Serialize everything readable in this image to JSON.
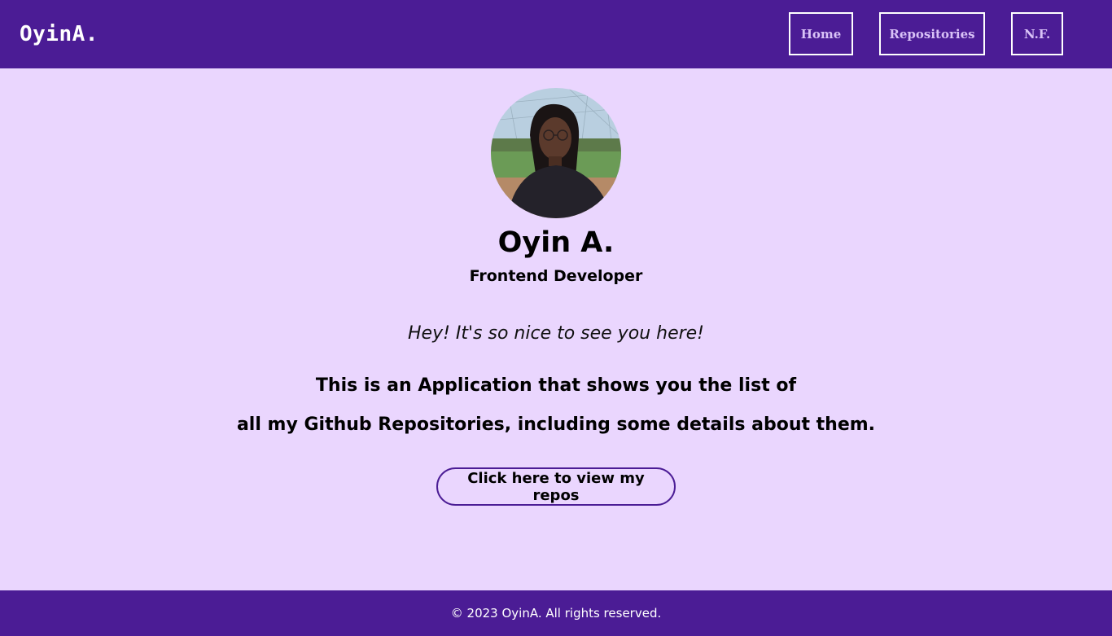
{
  "header": {
    "brand": "OyinA.",
    "nav": [
      {
        "label": "Home"
      },
      {
        "label": "Repositories"
      },
      {
        "label": "N.F."
      }
    ]
  },
  "profile": {
    "name": "Oyin A.",
    "role": "Frontend Developer"
  },
  "intro": {
    "greeting": "Hey! It's so nice to see you here!",
    "description_line1": "This is an Application that shows you the list of",
    "description_line2": "all my Github Repositories, including some details about them.",
    "cta_label": "Click here to view my repos"
  },
  "footer": {
    "copyright": "© 2023 OyinA. All rights reserved."
  },
  "colors": {
    "header_bg": "#4b1c95",
    "page_bg": "#ead6fe",
    "nav_text": "#d9c2f7"
  }
}
